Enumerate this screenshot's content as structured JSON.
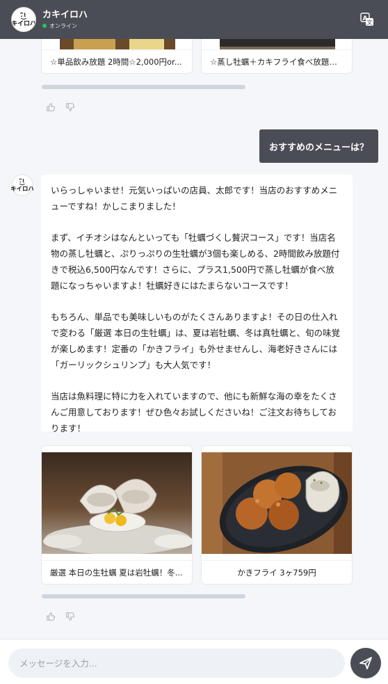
{
  "header": {
    "title": "カキイロハ",
    "status": "オンライン",
    "logo_text": "キイロハ"
  },
  "top_carousel": {
    "cards": [
      {
        "caption": "☆単品飲み放題 2時間☆2,000円or..."
      },
      {
        "caption": "☆蒸し牡蠣＋カキフライ食べ放題コー..."
      }
    ]
  },
  "user_message": {
    "text": "おすすめのメニューは？"
  },
  "bot_message": {
    "paragraphs": [
      "いらっしゃいませ！元気いっぱいの店員、太郎です！当店のおすすめメニューですね！かしこまりました！",
      "まず、イチオシはなんといっても「牡蠣づくし贅沢コース」です！当店名物の蒸し牡蠣と、ぷりっぷりの生牡蠣が3個も楽しめる、2時間飲み放題付きで税込6,500円なんです！さらに、プラス1,500円で蒸し牡蠣が食べ放題になっちゃいますよ！牡蠣好きにはたまらないコースです！",
      "もちろん、単品でも美味しいものがたくさんありますよ！その日の仕入れで変わる「厳選 本日の生牡蠣」は、夏は岩牡蠣、冬は真牡蠣と、旬の味覚が楽しめます！定番の「かきフライ」も外せませんし、海老好きさんには「ガーリックシュリンプ」も大人気です！",
      "当店は魚料理に特に力を入れていますので、他にも新鮮な海の幸をたくさんご用意しております！ぜひ色々お試しくださいね！ご注文お待ちしております！"
    ]
  },
  "bottom_carousel": {
    "cards": [
      {
        "caption": "厳選 本日の生牡蠣 夏は岩牡蠣！冬..."
      },
      {
        "caption": "かきフライ 3ヶ759円"
      }
    ]
  },
  "input": {
    "placeholder": "メッセージを入力..."
  },
  "colors": {
    "header_bg": "#4a4d55",
    "page_bg": "#f4f6f9",
    "online": "#22c55e"
  }
}
